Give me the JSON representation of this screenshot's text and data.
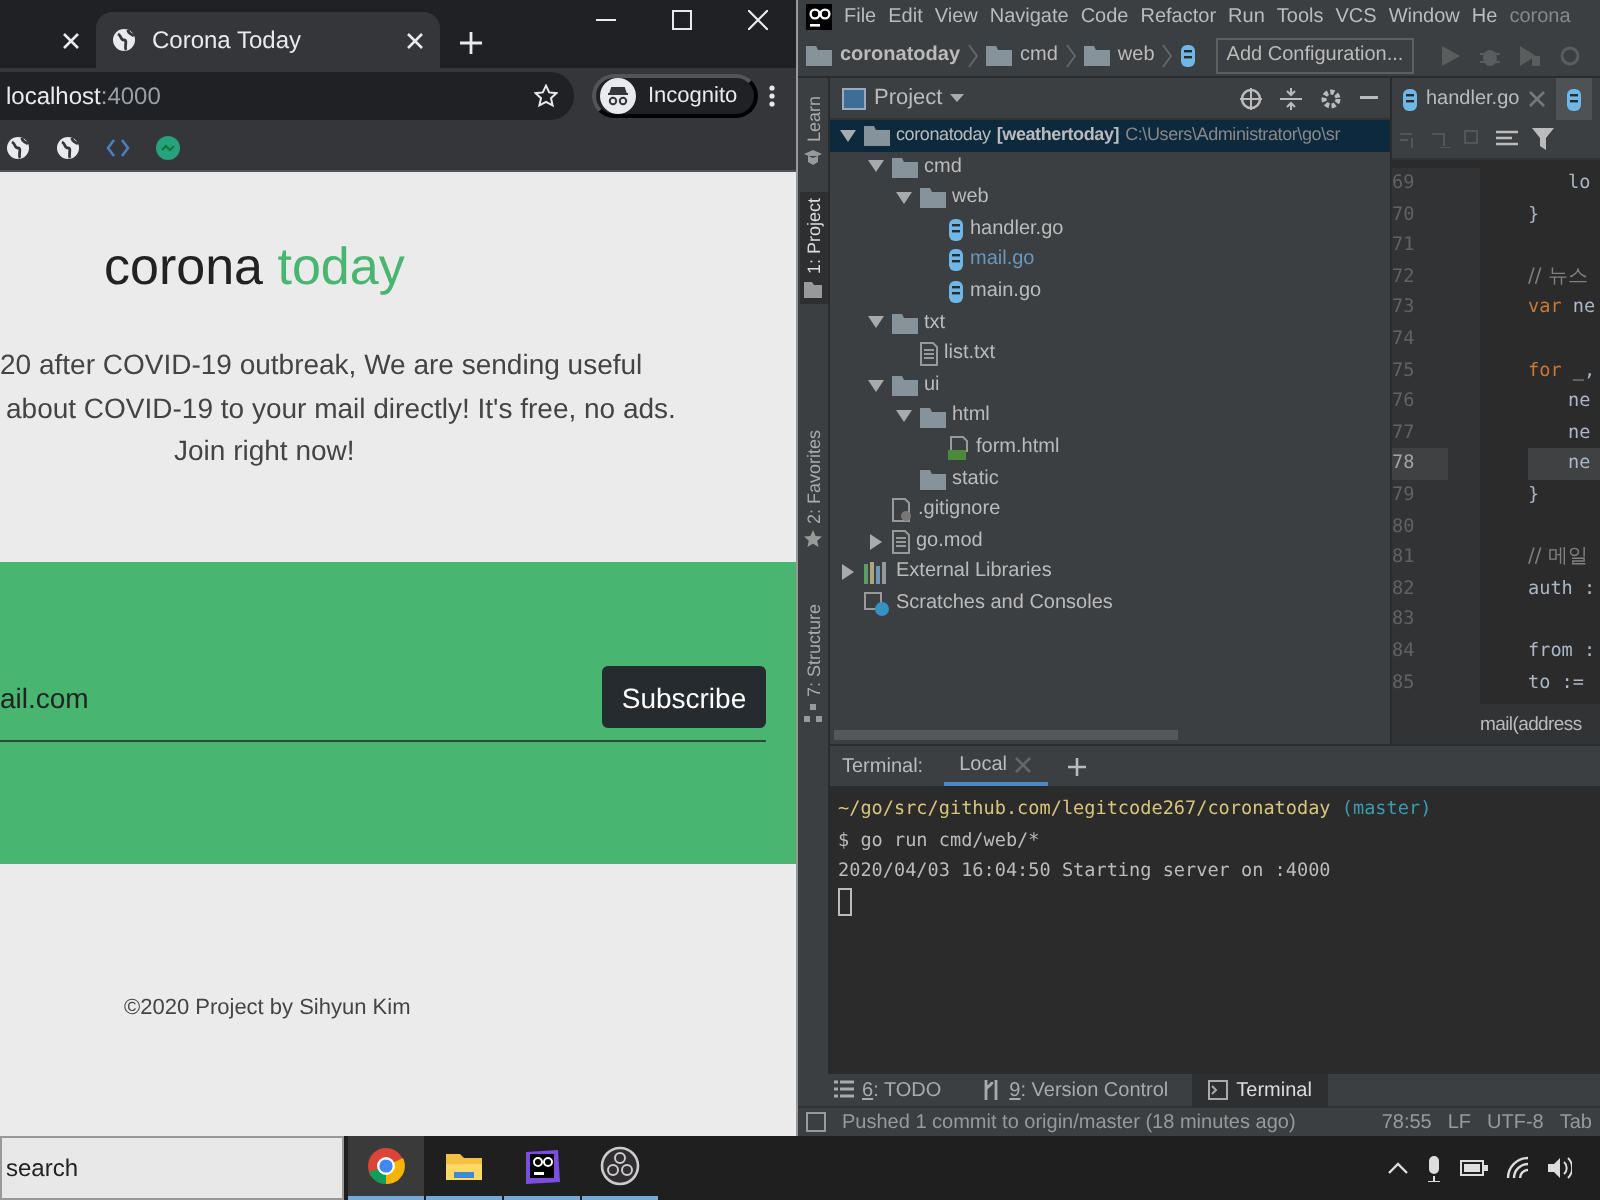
{
  "browser": {
    "tabs": [
      {
        "selected": false
      },
      {
        "label": "Corona Today",
        "selected": true
      }
    ],
    "address": {
      "host": "localhost",
      "port": ":4000"
    },
    "profile": "Incognito",
    "page": {
      "title": [
        {
          "text": "corona ",
          "accent": false
        },
        {
          "text": "today",
          "accent": true
        }
      ],
      "intro_lines": [
        "20 after COVID-19 outbreak, We are sending useful",
        "about COVID-19 to your mail directly! It's free, no ads.",
        "Join right now!"
      ],
      "email_field": {
        "value": "ail.com"
      },
      "subscribe": "Subscribe",
      "footer": "©2020 Project by Sihyun Kim"
    }
  },
  "ide": {
    "menu": [
      "File",
      "Edit",
      "View",
      "Navigate",
      "Code",
      "Refactor",
      "Run",
      "Tools",
      "VCS",
      "Window",
      "He"
    ],
    "project_title": "corona",
    "breadcrumbs": [
      "coronatoday",
      "cmd",
      "web"
    ],
    "run_config": "Add Configuration...",
    "side_tabs": [
      {
        "label": "Learn",
        "selected": false
      },
      {
        "label": "1: Project",
        "selected": true
      },
      {
        "label": "2: Favorites",
        "selected": false
      },
      {
        "label": "7: Structure",
        "selected": false
      }
    ],
    "project_label": "Project",
    "tree": [
      {
        "label": "coronatoday",
        "module": "[weathertoday]",
        "path": "C:\\Users\\Administrator\\go\\sr",
        "kind": "folder",
        "expanded": true,
        "selected": true,
        "modified": false,
        "children": [
          {
            "label": "cmd",
            "kind": "folder",
            "expanded": true,
            "selected": false,
            "modified": false,
            "children": [
              {
                "label": "web",
                "kind": "folder",
                "expanded": true,
                "selected": false,
                "modified": false,
                "children": [
                  {
                    "label": "handler.go",
                    "kind": "go",
                    "selected": false,
                    "modified": false
                  },
                  {
                    "label": "mail.go",
                    "kind": "go",
                    "selected": false,
                    "modified": true
                  },
                  {
                    "label": "main.go",
                    "kind": "go",
                    "selected": false,
                    "modified": false
                  }
                ]
              }
            ]
          },
          {
            "label": "txt",
            "kind": "folder",
            "expanded": true,
            "selected": false,
            "modified": false,
            "children": [
              {
                "label": "list.txt",
                "kind": "text",
                "selected": false,
                "modified": false
              }
            ]
          },
          {
            "label": "ui",
            "kind": "folder",
            "expanded": true,
            "selected": false,
            "modified": false,
            "children": [
              {
                "label": "html",
                "kind": "folder",
                "expanded": true,
                "selected": false,
                "modified": false,
                "children": [
                  {
                    "label": "form.html",
                    "kind": "html",
                    "selected": false,
                    "modified": false
                  }
                ]
              },
              {
                "label": "static",
                "kind": "folder",
                "selected": false,
                "modified": false
              }
            ]
          },
          {
            "label": ".gitignore",
            "kind": "ignore",
            "selected": false,
            "modified": false
          },
          {
            "label": "go.mod",
            "kind": "text",
            "expanded": false,
            "selected": false,
            "modified": false
          }
        ]
      },
      {
        "label": "External Libraries",
        "kind": "libs",
        "expanded": false,
        "selected": false,
        "modified": false
      },
      {
        "label": "Scratches and Consoles",
        "kind": "scratch",
        "selected": false,
        "modified": false
      }
    ],
    "editor": {
      "tabs": [
        {
          "label": "handler.go",
          "selected": false
        },
        {
          "selected": true
        }
      ],
      "lines": [
        {
          "number": "69",
          "indented": true,
          "current": false,
          "tokens": [
            {
              "text": "lo",
              "kind": "plain"
            }
          ]
        },
        {
          "number": "70",
          "indented": false,
          "current": false,
          "tokens": [
            {
              "text": "}",
              "kind": "plain"
            }
          ]
        },
        {
          "number": "71",
          "current": false
        },
        {
          "number": "72",
          "indented": false,
          "current": false,
          "tokens": [
            {
              "text": "// 뉴스",
              "kind": "comment"
            }
          ]
        },
        {
          "number": "73",
          "indented": false,
          "current": false,
          "tokens": [
            {
              "text": "var",
              "kind": "keyword"
            },
            {
              "text": " ne",
              "kind": "plain"
            }
          ]
        },
        {
          "number": "74",
          "current": false
        },
        {
          "number": "75",
          "indented": false,
          "current": false,
          "tokens": [
            {
              "text": "for",
              "kind": "keyword"
            },
            {
              "text": " _,",
              "kind": "plain"
            }
          ]
        },
        {
          "number": "76",
          "indented": true,
          "current": false,
          "tokens": [
            {
              "text": "ne",
              "kind": "plain"
            }
          ]
        },
        {
          "number": "77",
          "indented": true,
          "current": false,
          "tokens": [
            {
              "text": "ne",
              "kind": "plain"
            }
          ]
        },
        {
          "number": "78",
          "indented": true,
          "current": true,
          "tokens": [
            {
              "text": "ne",
              "kind": "plain"
            }
          ]
        },
        {
          "number": "79",
          "indented": false,
          "current": false,
          "tokens": [
            {
              "text": "}",
              "kind": "plain"
            }
          ]
        },
        {
          "number": "80",
          "current": false
        },
        {
          "number": "81",
          "indented": false,
          "current": false,
          "tokens": [
            {
              "text": "// 메일",
              "kind": "comment"
            }
          ]
        },
        {
          "number": "82",
          "indented": false,
          "current": false,
          "tokens": [
            {
              "text": "auth :",
              "kind": "plain"
            }
          ]
        },
        {
          "number": "83",
          "current": false
        },
        {
          "number": "84",
          "indented": false,
          "current": false,
          "tokens": [
            {
              "text": "from :",
              "kind": "plain"
            }
          ]
        },
        {
          "number": "85",
          "indented": false,
          "current": false,
          "tokens": [
            {
              "text": "to :=",
              "kind": "plain"
            }
          ]
        }
      ],
      "breadcrumb": "mail(address"
    },
    "terminal": {
      "label": "Terminal:",
      "sessions": [
        {
          "label": "Local",
          "selected": true
        }
      ],
      "prompt_path": "~/go/src/github.com/legitcode267/coronatoday",
      "branch": "(master)",
      "lines": [
        "$ go run cmd/web/*",
        "2020/04/03 16:04:50 Starting server on :4000"
      ]
    },
    "tool_tabs": [
      {
        "number": "6",
        "label": ": TODO",
        "kind": "todo",
        "selected": false
      },
      {
        "number": "9",
        "label": ": Version Control",
        "kind": "vcs",
        "selected": false
      },
      {
        "label": "Terminal",
        "kind": "terminal",
        "selected": true
      }
    ],
    "status": {
      "message": "Pushed 1 commit to origin/master (18 minutes ago)",
      "position": "78:55",
      "line_sep": "LF",
      "encoding": "UTF-8",
      "indent": "Tab"
    }
  },
  "taskbar": {
    "search": "search",
    "apps": [
      {
        "kind": "chrome",
        "selected": true
      },
      {
        "kind": "folder",
        "selected": false
      },
      {
        "kind": "goland",
        "selected": false
      },
      {
        "kind": "obs",
        "selected": false
      }
    ]
  }
}
